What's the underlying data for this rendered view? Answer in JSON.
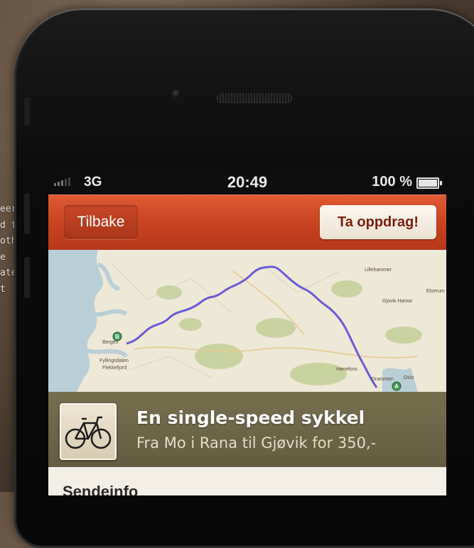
{
  "background_text": {
    "lines": [
      "eer",
      "d to",
      "other",
      "e",
      "ate",
      "t"
    ]
  },
  "status_bar": {
    "carrier": "3G",
    "time": "20:49",
    "battery": "100 %",
    "battery_level": 1.0
  },
  "nav_bar": {
    "back_label": "Tilbake",
    "action_label": "Ta oppdrag!"
  },
  "map": {
    "labels": [
      "Lillehammer",
      "Gjovik Hamar",
      "Elverum",
      "Hønefoss",
      "Drammen",
      "Oslo",
      "Bergen",
      "Fyllingsdalen",
      "Flekkefjord"
    ],
    "markers": [
      "B",
      "A"
    ],
    "colors": {
      "water": "#b9cfd8",
      "land": "#eee8d6",
      "forest": "#c9d3a2",
      "route": "#6a5bd8"
    }
  },
  "listing": {
    "title": "En single-speed sykkel",
    "subtitle": "Fra Mo i Rana til Gjøvik for 350,-",
    "thumbnail_icon": "bicycle-icon"
  },
  "info_section": {
    "heading": "Sendeinfo"
  },
  "colors": {
    "nav_accent": "#c8421f",
    "cta_text": "#7a1e0c"
  }
}
